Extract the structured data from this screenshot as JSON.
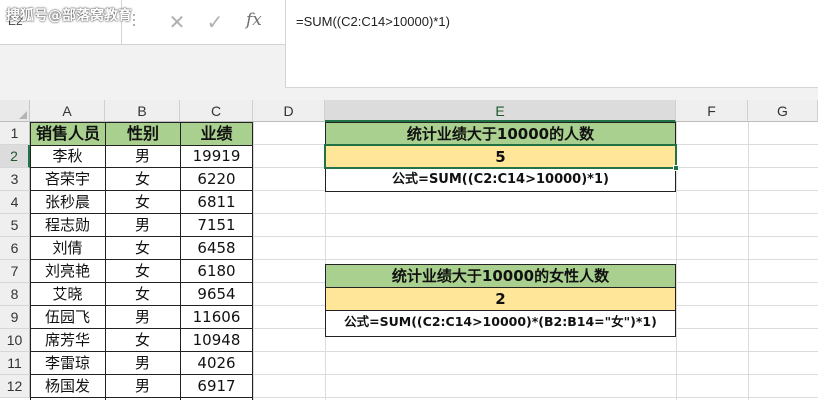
{
  "watermark": "搜狐号@部落窝教育",
  "name_box": "E2",
  "formula_bar": {
    "cancel_icon": "✕",
    "enter_icon": "✓",
    "fx_label": "fx",
    "formula": "=SUM((C2:C14>10000)*1)"
  },
  "columns": [
    "A",
    "B",
    "C",
    "D",
    "E",
    "F",
    "G"
  ],
  "rows": [
    "1",
    "2",
    "3",
    "4",
    "5",
    "6",
    "7",
    "8",
    "9",
    "10",
    "11",
    "12"
  ],
  "table": {
    "headers": [
      "销售人员",
      "性别",
      "业绩"
    ],
    "records": [
      [
        "李秋",
        "男",
        "19919"
      ],
      [
        "吝荣宇",
        "女",
        "6220"
      ],
      [
        "张秒晨",
        "女",
        "6811"
      ],
      [
        "程志勋",
        "男",
        "7151"
      ],
      [
        "刘倩",
        "女",
        "6458"
      ],
      [
        "刘亮艳",
        "女",
        "6180"
      ],
      [
        "艾晓",
        "女",
        "9654"
      ],
      [
        "伍园飞",
        "男",
        "11606"
      ],
      [
        "席芳华",
        "女",
        "10948"
      ],
      [
        "李雷琼",
        "男",
        "4026"
      ],
      [
        "杨国发",
        "男",
        "6917"
      ]
    ]
  },
  "box1": {
    "title": "统计业绩大于10000的人数",
    "value": "5",
    "formula": "公式=SUM((C2:C14>10000)*1)"
  },
  "box2": {
    "title": "统计业绩大于10000的女性人数",
    "value": "2",
    "formula": "公式=SUM((C2:C14>10000)*(B2:B14=\"女\")*1)"
  },
  "colors": {
    "header_green": "#a9d08e",
    "value_yellow": "#ffe699",
    "selection_green": "#217346"
  }
}
